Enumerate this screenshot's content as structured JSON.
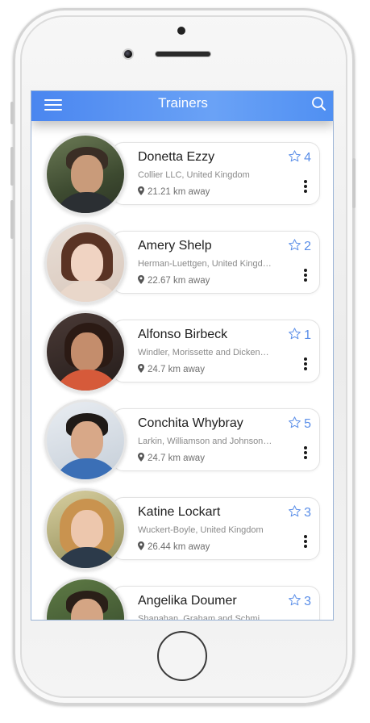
{
  "header": {
    "title": "Trainers"
  },
  "icons": {
    "menu": "hamburger-menu-icon",
    "search": "search-icon",
    "location": "map-pin-icon",
    "rating": "star-outline-icon",
    "more": "vertical-ellipsis-icon"
  },
  "colors": {
    "header_start": "#4a86f0",
    "header_end": "#6aa2f6",
    "accent": "#5a8ee8"
  },
  "trainers": [
    {
      "name": "Donetta Ezzy",
      "company": "Collier LLC, United Kingdom",
      "distance": "21.21 km away",
      "rating": "4"
    },
    {
      "name": "Amery Shelp",
      "company": "Herman-Luettgen, United Kingdom",
      "distance": "22.67 km away",
      "rating": "2"
    },
    {
      "name": "Alfonso Birbeck",
      "company": "Windler, Morissette and Dickens, United Kingdom",
      "distance": "24.7 km away",
      "rating": "1"
    },
    {
      "name": "Conchita Whybray",
      "company": "Larkin, Williamson and Johnson, United Kingdom",
      "distance": "24.7 km away",
      "rating": "5"
    },
    {
      "name": "Katine Lockart",
      "company": "Wuckert-Boyle, United Kingdom",
      "distance": "26.44 km away",
      "rating": "3"
    },
    {
      "name": "Angelika Doumer",
      "company": "Shanahan, Graham and Schmidt, United Kingdom",
      "distance": "",
      "rating": "3"
    }
  ]
}
